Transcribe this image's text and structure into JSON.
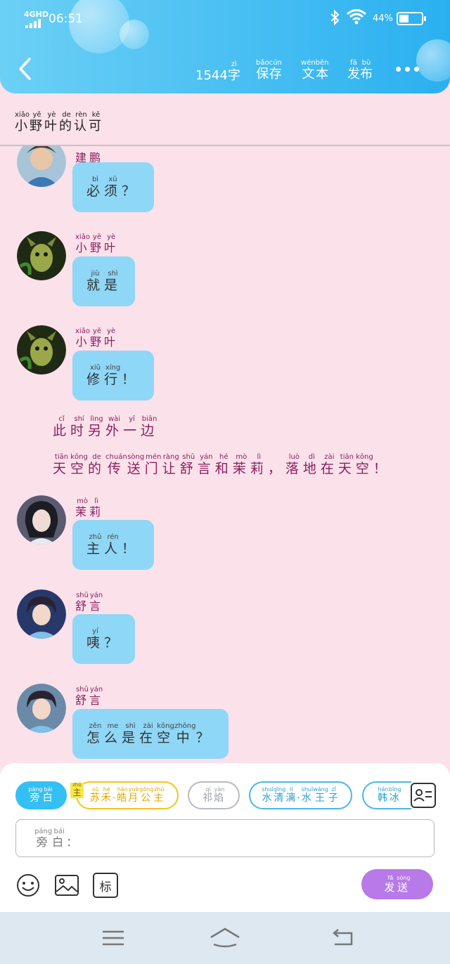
{
  "status_bar": {
    "network": "4GHD",
    "time": "06:51",
    "battery": "44%"
  },
  "header": {
    "word_count": "1544",
    "zi": {
      "text": "字",
      "pinyin": "zì"
    },
    "save": [
      {
        "t": "保",
        "p": "bǎo"
      },
      {
        "t": "存",
        "p": "cún"
      }
    ],
    "text": [
      {
        "t": "文",
        "p": "wén"
      },
      {
        "t": "本",
        "p": "běn"
      }
    ],
    "publish": [
      {
        "t": "发",
        "p": "fā"
      },
      {
        "t": "布",
        "p": "bù"
      }
    ]
  },
  "story_title": [
    {
      "t": "小",
      "p": "xiǎo"
    },
    {
      "t": "野",
      "p": "yě"
    },
    {
      "t": "叶",
      "p": "yè"
    },
    {
      "t": "的",
      "p": "de"
    },
    {
      "t": "认",
      "p": "rèn"
    },
    {
      "t": "可",
      "p": "kě"
    }
  ],
  "messages": [
    {
      "speaker": [
        {
          "t": "建",
          "p": ""
        },
        {
          "t": "鹏",
          "p": ""
        }
      ],
      "text": [
        {
          "t": "必",
          "p": "bì"
        },
        {
          "t": "须",
          "p": "xū"
        },
        {
          "t": "？",
          "p": ""
        }
      ],
      "avatar": "green"
    },
    {
      "speaker": [
        {
          "t": "小",
          "p": "xiǎo"
        },
        {
          "t": "野",
          "p": "yě"
        },
        {
          "t": "叶",
          "p": "yè"
        }
      ],
      "text": [
        {
          "t": "就",
          "p": "jiù"
        },
        {
          "t": "是",
          "p": "shì"
        }
      ],
      "avatar": "green"
    },
    {
      "speaker": [
        {
          "t": "小",
          "p": "xiǎo"
        },
        {
          "t": "野",
          "p": "yě"
        },
        {
          "t": "叶",
          "p": "yè"
        }
      ],
      "text": [
        {
          "t": "修",
          "p": "xiū"
        },
        {
          "t": "行",
          "p": "xíng"
        },
        {
          "t": "！",
          "p": ""
        }
      ],
      "avatar": "green"
    },
    {
      "speaker": [
        {
          "t": "茉",
          "p": "mò"
        },
        {
          "t": "莉",
          "p": "lì"
        }
      ],
      "text": [
        {
          "t": "主",
          "p": "zhǔ"
        },
        {
          "t": "人",
          "p": "rén"
        },
        {
          "t": "！",
          "p": ""
        }
      ],
      "avatar": "dark"
    },
    {
      "speaker": [
        {
          "t": "舒",
          "p": "shū"
        },
        {
          "t": "言",
          "p": "yán"
        }
      ],
      "text": [
        {
          "t": "咦",
          "p": "yí"
        },
        {
          "t": "？",
          "p": ""
        }
      ],
      "avatar": "blue"
    },
    {
      "speaker": [
        {
          "t": "舒",
          "p": "shū"
        },
        {
          "t": "言",
          "p": "yán"
        }
      ],
      "text": [
        {
          "t": "怎",
          "p": "zěn"
        },
        {
          "t": "么",
          "p": "me"
        },
        {
          "t": "是",
          "p": "shì"
        },
        {
          "t": "在",
          "p": "zài"
        },
        {
          "t": "空",
          "p": "kōng"
        },
        {
          "t": "中",
          "p": "zhōng"
        },
        {
          "t": "？",
          "p": ""
        }
      ],
      "avatar": "blue"
    }
  ],
  "narration": [
    [
      {
        "t": "此",
        "p": "cǐ"
      },
      {
        "t": "时",
        "p": "shí"
      },
      {
        "t": "另",
        "p": "lìng"
      },
      {
        "t": "外",
        "p": "wài"
      },
      {
        "t": "一",
        "p": "yī"
      },
      {
        "t": "边",
        "p": "biān"
      }
    ],
    [
      {
        "t": "天",
        "p": "tiān"
      },
      {
        "t": "空",
        "p": "kōng"
      },
      {
        "t": "的",
        "p": "de"
      },
      {
        "t": "传",
        "p": "chuán"
      },
      {
        "t": "送",
        "p": "sòng"
      },
      {
        "t": "门",
        "p": "mén"
      },
      {
        "t": "让",
        "p": "ràng"
      },
      {
        "t": "舒",
        "p": "shū"
      },
      {
        "t": "言",
        "p": "yán"
      },
      {
        "t": "和",
        "p": "hé"
      },
      {
        "t": "茉",
        "p": "mò"
      },
      {
        "t": "莉",
        "p": "lì"
      },
      {
        "t": "，",
        "p": ""
      },
      {
        "t": "落",
        "p": "luò"
      },
      {
        "t": "地",
        "p": "dì"
      },
      {
        "t": "在",
        "p": "zài"
      },
      {
        "t": "天",
        "p": "tiān"
      },
      {
        "t": "空",
        "p": "kōng"
      },
      {
        "t": "！",
        "p": ""
      }
    ]
  ],
  "roles": {
    "narrator": [
      {
        "t": "旁",
        "p": "páng"
      },
      {
        "t": "白",
        "p": "bái"
      }
    ],
    "main_tag": {
      "t": "主",
      "p": "zhǔ"
    },
    "su": [
      {
        "t": "苏",
        "p": "sū"
      },
      {
        "t": "禾",
        "p": "hé"
      },
      {
        "t": "·",
        "p": ""
      },
      {
        "t": "皓",
        "p": "hào"
      },
      {
        "t": "月",
        "p": "yuè"
      },
      {
        "t": "公",
        "p": "gōng"
      },
      {
        "t": "主",
        "p": "zhǔ"
      }
    ],
    "qi": [
      {
        "t": "祁",
        "p": "qí"
      },
      {
        "t": "焰",
        "p": "yàn"
      }
    ],
    "shui": [
      {
        "t": "水",
        "p": "shuǐ"
      },
      {
        "t": "清",
        "p": "qīng"
      },
      {
        "t": "漓",
        "p": "lí"
      },
      {
        "t": "·",
        "p": ""
      },
      {
        "t": "水",
        "p": "shuǐ"
      },
      {
        "t": "王",
        "p": "wáng"
      },
      {
        "t": "子",
        "p": "zǐ"
      }
    ],
    "han": [
      {
        "t": "韩",
        "p": "hán"
      },
      {
        "t": "冰",
        "p": "bīng"
      }
    ]
  },
  "input": {
    "label": [
      {
        "t": "旁",
        "p": "páng"
      },
      {
        "t": "白",
        "p": "bái"
      },
      {
        "t": "：",
        "p": ""
      }
    ],
    "value": ""
  },
  "tag_button": "标",
  "send_button": [
    {
      "t": "发",
      "p": "fā"
    },
    {
      "t": "送",
      "p": "sòng"
    }
  ],
  "colors": {
    "header": "#2ab0f0",
    "bubble": "#8fd7f6",
    "speaker": "#8b1f5e",
    "send": "#b77ae8",
    "background": "#fbe1ea"
  }
}
